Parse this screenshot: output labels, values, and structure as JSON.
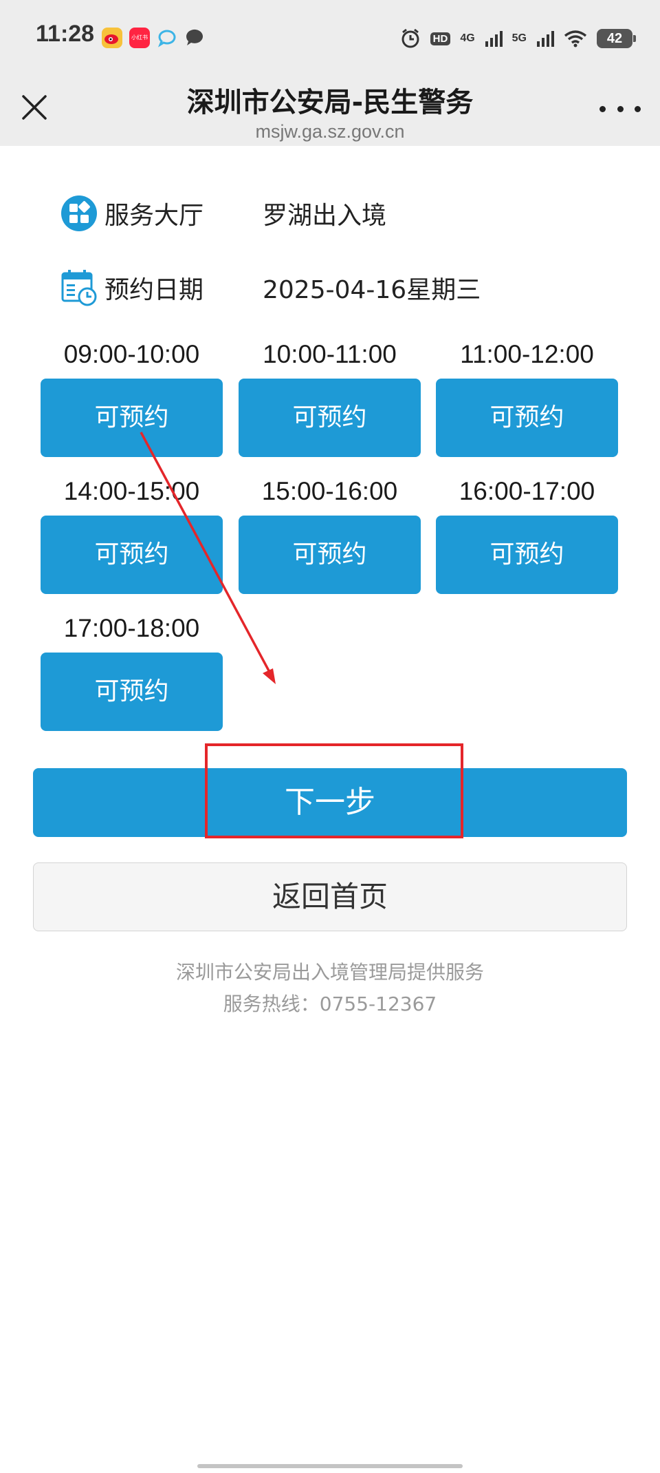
{
  "status_bar": {
    "time": "11:28",
    "notif_app_label": "小红书",
    "hd_label": "HD",
    "net1_label": "4G",
    "net2_label": "5G",
    "battery": "42"
  },
  "header": {
    "title": "深圳市公安局-民生警务",
    "url": "msjw.ga.sz.gov.cn"
  },
  "info": {
    "hall_label": "服务大厅",
    "hall_value": "罗湖出入境",
    "date_label": "预约日期",
    "date_value": "2025-04-16星期三"
  },
  "slots": [
    {
      "time": "09:00-10:00",
      "status": "可预约"
    },
    {
      "time": "10:00-11:00",
      "status": "可预约"
    },
    {
      "time": "11:00-12:00",
      "status": "可预约"
    },
    {
      "time": "14:00-15:00",
      "status": "可预约"
    },
    {
      "time": "15:00-16:00",
      "status": "可预约"
    },
    {
      "time": "16:00-17:00",
      "status": "可预约"
    },
    {
      "time": "17:00-18:00",
      "status": "可预约"
    }
  ],
  "actions": {
    "next_label": "下一步",
    "home_label": "返回首页"
  },
  "footer": {
    "provider": "深圳市公安局出入境管理局提供服务",
    "hotline": "服务热线：0755-12367"
  },
  "colors": {
    "accent": "#1e9ad6",
    "annotation": "#e4262a"
  }
}
